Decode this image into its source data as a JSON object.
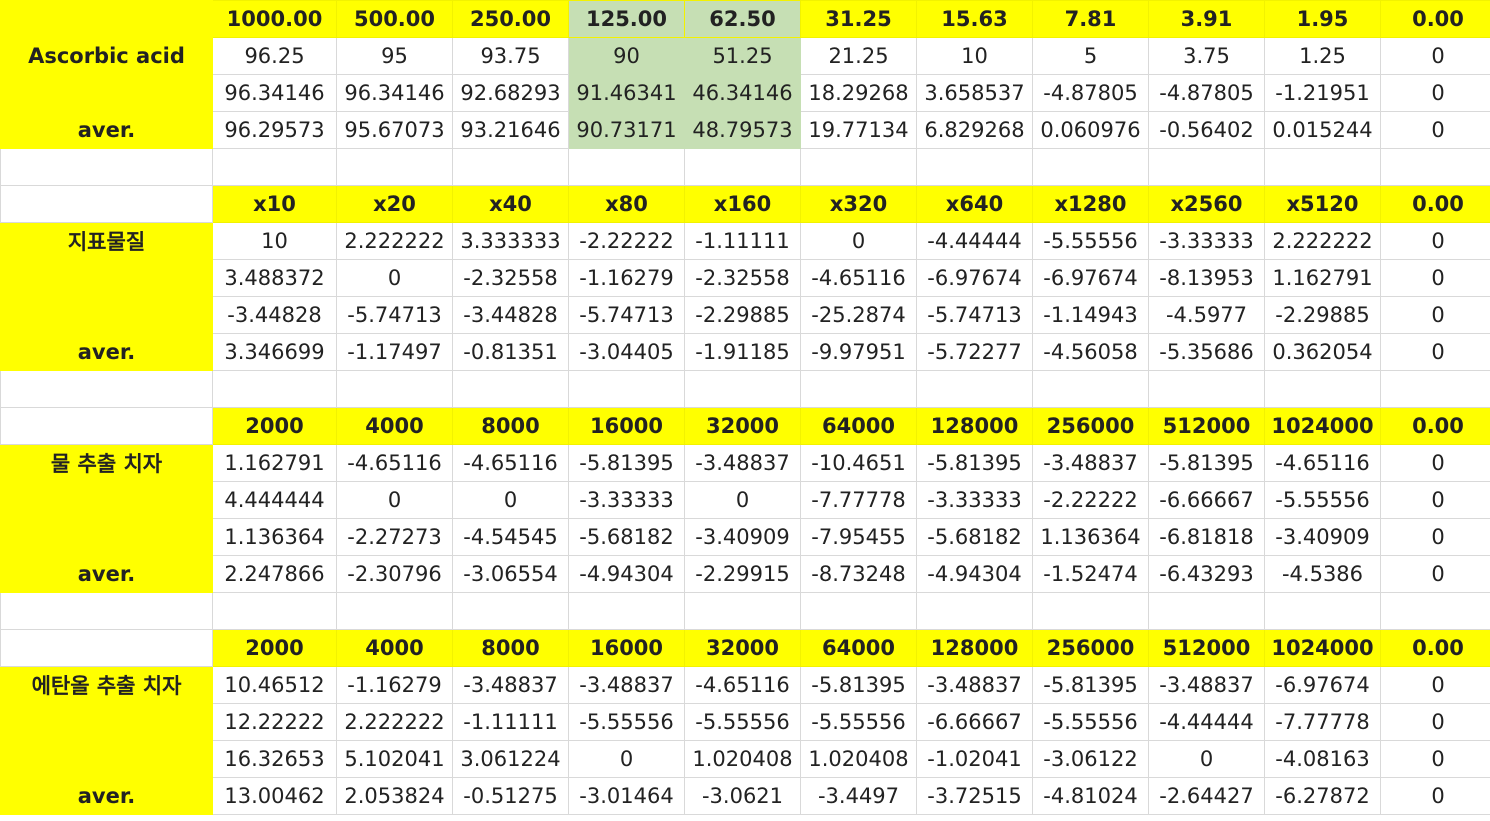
{
  "colors": {
    "header_fill": "#ffff00",
    "highlight_fill": "#c6dfb4",
    "grid_line": "#d9d9d9"
  },
  "blocks": [
    {
      "header": [
        "1000.00",
        "500.00",
        "250.00",
        "125.00",
        "62.50",
        "31.25",
        "15.63",
        "7.81",
        "3.91",
        "1.95",
        "0.00"
      ],
      "rows": [
        {
          "label": "Ascorbic acid",
          "values": [
            "96.25",
            "95",
            "93.75",
            "90",
            "51.25",
            "21.25",
            "10",
            "5",
            "3.75",
            "1.25",
            "0"
          ]
        },
        {
          "label": "",
          "values": [
            "96.34146",
            "96.34146",
            "92.68293",
            "91.46341",
            "46.34146",
            "18.29268",
            "3.658537",
            "-4.87805",
            "-4.87805",
            "-1.21951",
            "0"
          ]
        },
        {
          "label": "aver.",
          "values": [
            "96.29573",
            "95.67073",
            "93.21646",
            "90.73171",
            "48.79573",
            "19.77134",
            "6.829268",
            "0.060976",
            "-0.56402",
            "0.015244",
            "0"
          ]
        }
      ]
    },
    {
      "header": [
        "x10",
        "x20",
        "x40",
        "x80",
        "x160",
        "x320",
        "x640",
        "x1280",
        "x2560",
        "x5120",
        "0.00"
      ],
      "rows": [
        {
          "label": "지표물질",
          "values": [
            "10",
            "2.222222",
            "3.333333",
            "-2.22222",
            "-1.11111",
            "0",
            "-4.44444",
            "-5.55556",
            "-3.33333",
            "2.222222",
            "0"
          ]
        },
        {
          "label": "",
          "values": [
            "3.488372",
            "0",
            "-2.32558",
            "-1.16279",
            "-2.32558",
            "-4.65116",
            "-6.97674",
            "-6.97674",
            "-8.13953",
            "1.162791",
            "0"
          ]
        },
        {
          "label": "",
          "values": [
            "-3.44828",
            "-5.74713",
            "-3.44828",
            "-5.74713",
            "-2.29885",
            "-25.2874",
            "-5.74713",
            "-1.14943",
            "-4.5977",
            "-2.29885",
            "0"
          ]
        },
        {
          "label": "aver.",
          "values": [
            "3.346699",
            "-1.17497",
            "-0.81351",
            "-3.04405",
            "-1.91185",
            "-9.97951",
            "-5.72277",
            "-4.56058",
            "-5.35686",
            "0.362054",
            "0"
          ]
        }
      ]
    },
    {
      "header": [
        "2000",
        "4000",
        "8000",
        "16000",
        "32000",
        "64000",
        "128000",
        "256000",
        "512000",
        "1024000",
        "0.00"
      ],
      "rows": [
        {
          "label": "물 추출 치자",
          "values": [
            "1.162791",
            "-4.65116",
            "-4.65116",
            "-5.81395",
            "-3.48837",
            "-10.4651",
            "-5.81395",
            "-3.48837",
            "-5.81395",
            "-4.65116",
            "0"
          ]
        },
        {
          "label": "",
          "values": [
            "4.444444",
            "0",
            "0",
            "-3.33333",
            "0",
            "-7.77778",
            "-3.33333",
            "-2.22222",
            "-6.66667",
            "-5.55556",
            "0"
          ]
        },
        {
          "label": "",
          "values": [
            "1.136364",
            "-2.27273",
            "-4.54545",
            "-5.68182",
            "-3.40909",
            "-7.95455",
            "-5.68182",
            "1.136364",
            "-6.81818",
            "-3.40909",
            "0"
          ]
        },
        {
          "label": "aver.",
          "values": [
            "2.247866",
            "-2.30796",
            "-3.06554",
            "-4.94304",
            "-2.29915",
            "-8.73248",
            "-4.94304",
            "-1.52474",
            "-6.43293",
            "-4.5386",
            "0"
          ]
        }
      ]
    },
    {
      "header": [
        "2000",
        "4000",
        "8000",
        "16000",
        "32000",
        "64000",
        "128000",
        "256000",
        "512000",
        "1024000",
        "0.00"
      ],
      "rows": [
        {
          "label": "에탄올 추출 치자",
          "values": [
            "10.46512",
            "-1.16279",
            "-3.48837",
            "-3.48837",
            "-4.65116",
            "-5.81395",
            "-3.48837",
            "-5.81395",
            "-3.48837",
            "-6.97674",
            "0"
          ]
        },
        {
          "label": "",
          "values": [
            "12.22222",
            "2.222222",
            "-1.11111",
            "-5.55556",
            "-5.55556",
            "-5.55556",
            "-6.66667",
            "-5.55556",
            "-4.44444",
            "-7.77778",
            "0"
          ]
        },
        {
          "label": "",
          "values": [
            "16.32653",
            "5.102041",
            "3.061224",
            "0",
            "1.020408",
            "1.020408",
            "-1.02041",
            "-3.06122",
            "0",
            "-4.08163",
            "0"
          ]
        },
        {
          "label": "aver.",
          "values": [
            "13.00462",
            "2.053824",
            "-0.51275",
            "-3.01464",
            "-3.0621",
            "-3.4497",
            "-3.72515",
            "-4.81024",
            "-2.64427",
            "-6.27872",
            "0"
          ]
        }
      ]
    }
  ]
}
